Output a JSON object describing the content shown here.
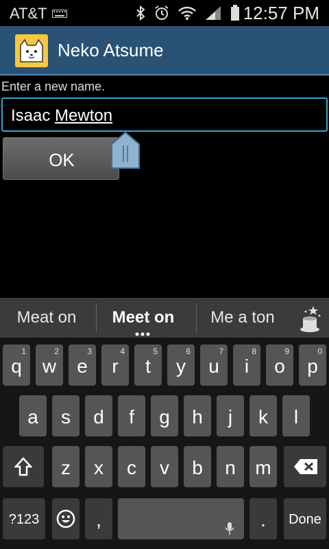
{
  "status_bar": {
    "carrier": "AT&T",
    "time": "12:57 PM"
  },
  "app": {
    "title": "Neko Atsume"
  },
  "dialog": {
    "prompt": "Enter a new name.",
    "input_value_prefix": "Isaac ",
    "input_value_composing": "Mewton",
    "ok_label": "OK"
  },
  "suggestions": [
    "Meat on",
    "Meet on",
    "Me a ton"
  ],
  "keyboard": {
    "row1": [
      {
        "label": "q",
        "hint": "1"
      },
      {
        "label": "w",
        "hint": "2"
      },
      {
        "label": "e",
        "hint": "3"
      },
      {
        "label": "r",
        "hint": "4"
      },
      {
        "label": "t",
        "hint": "5"
      },
      {
        "label": "y",
        "hint": "6"
      },
      {
        "label": "u",
        "hint": "7"
      },
      {
        "label": "i",
        "hint": "8"
      },
      {
        "label": "o",
        "hint": "9"
      },
      {
        "label": "p",
        "hint": "0"
      }
    ],
    "row2": [
      "a",
      "s",
      "d",
      "f",
      "g",
      "h",
      "j",
      "k",
      "l"
    ],
    "row3": [
      "z",
      "x",
      "c",
      "v",
      "b",
      "n",
      "m"
    ],
    "symbols_label": "?123",
    "comma_label": ",",
    "period_label": ".",
    "done_label": "Done"
  }
}
